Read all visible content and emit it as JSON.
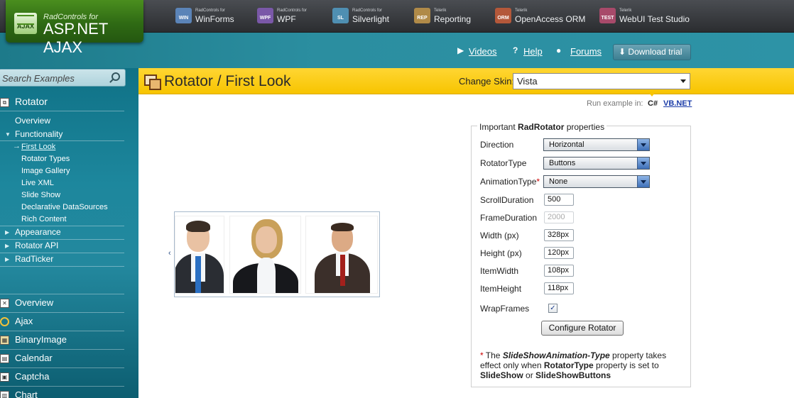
{
  "header": {
    "logo_small": "RadControls for",
    "logo_big": "ASP.NET AJAX",
    "logo_badge": "AJAX",
    "products": [
      {
        "badge": "WIN",
        "small": "RadControls for",
        "name": "WinForms",
        "color": "#5b84b8"
      },
      {
        "badge": "WPF",
        "small": "RadControls for",
        "name": "WPF",
        "color": "#7a58a8"
      },
      {
        "badge": "SL",
        "small": "RadControls for",
        "name": "Silverlight",
        "color": "#4f8fb2"
      },
      {
        "badge": "REP",
        "small": "Telerik",
        "name": "Reporting",
        "color": "#b08a48"
      },
      {
        "badge": "ORM",
        "small": "Telerik",
        "name": "OpenAccess ORM",
        "color": "#b4583a"
      },
      {
        "badge": "TEST",
        "small": "Telerik",
        "name": "WebUI Test Studio",
        "color": "#a84a6a"
      }
    ]
  },
  "links": {
    "videos": "Videos",
    "help": "Help",
    "forums": "Forums",
    "download": "Download trial"
  },
  "sidebar": {
    "search_placeholder": "Search Examples",
    "section": "Rotator",
    "overview": "Overview",
    "functionality": "Functionality",
    "sub_items": [
      "First Look",
      "Rotator Types",
      "Image Gallery",
      "Live XML",
      "Slide Show",
      "Declarative DataSources",
      "Rich Content"
    ],
    "groups": [
      "Appearance",
      "Rotator API",
      "RadTicker"
    ],
    "controls": [
      "Overview",
      "Ajax",
      "BinaryImage",
      "Calendar",
      "Captcha",
      "Chart"
    ]
  },
  "page": {
    "title": "Rotator / First Look",
    "change_skin_label": "Change Skin:",
    "skin_value": "Vista",
    "run_label": "Run example in:",
    "run_cs": "C#",
    "run_vb": "VB.NET"
  },
  "rotator": {
    "prev_arrow": "‹",
    "next_arrow": "›"
  },
  "properties": {
    "legend_pre": "Important ",
    "legend_bold": "RadRotator",
    "legend_post": " properties",
    "direction_label": "Direction",
    "direction_value": "Horizontal",
    "rotator_type_label": "RotatorType",
    "rotator_type_value": "Buttons",
    "animation_label": "AnimationType",
    "animation_req": "*",
    "animation_value": "None",
    "scroll_label": "ScrollDuration",
    "scroll_value": "500",
    "frame_label": "FrameDuration",
    "frame_value": "2000",
    "width_label": "Width (px)",
    "width_value": "328px",
    "height_label": "Height (px)",
    "height_value": "120px",
    "item_width_label": "ItemWidth",
    "item_width_value": "108px",
    "item_height_label": "ItemHeight",
    "item_height_value": "118px",
    "wrap_label": "WrapFrames",
    "wrap_checked": true,
    "wrap_check_glyph": "✓",
    "configure_button": "Configure Rotator"
  },
  "note": {
    "star": "*",
    "t1": " The ",
    "b1": "SlideShowAnimation-Type",
    "t2": " property takes effect only when ",
    "b2": "RotatorType",
    "t3": " property is set to ",
    "b3": "SlideShow",
    "t4": " or ",
    "b4": "SlideShowButtons"
  }
}
